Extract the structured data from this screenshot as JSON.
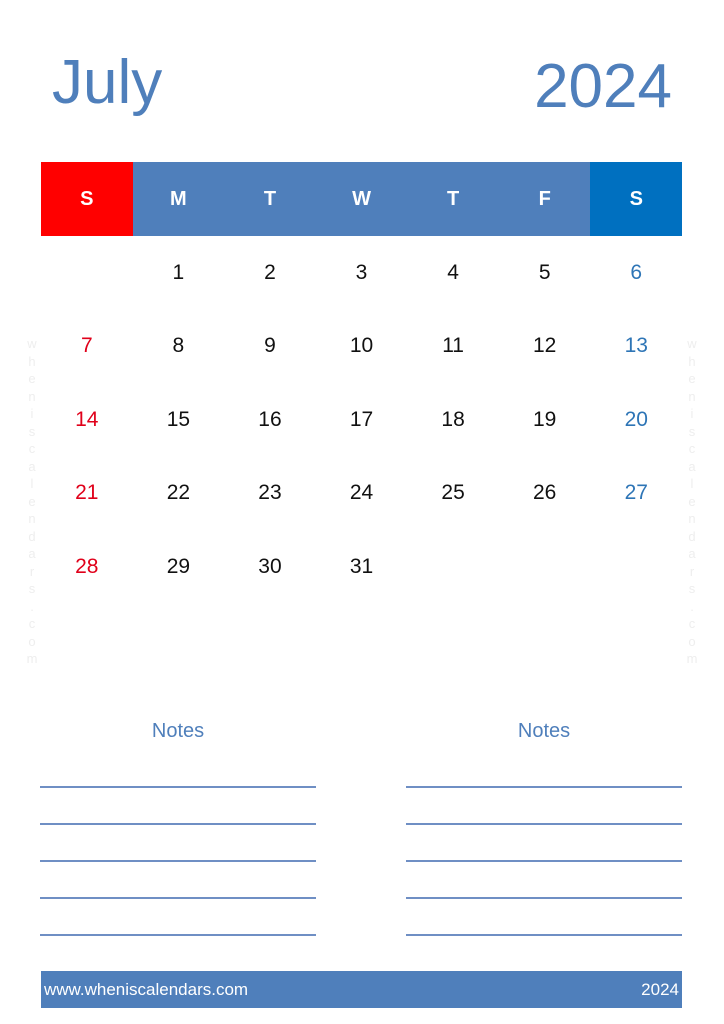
{
  "header": {
    "month": "July",
    "year": "2024"
  },
  "weekdays": [
    "S",
    "M",
    "T",
    "W",
    "T",
    "F",
    "S"
  ],
  "weeks": [
    [
      "",
      "1",
      "2",
      "3",
      "4",
      "5",
      "6"
    ],
    [
      "7",
      "8",
      "9",
      "10",
      "11",
      "12",
      "13"
    ],
    [
      "14",
      "15",
      "16",
      "17",
      "18",
      "19",
      "20"
    ],
    [
      "21",
      "22",
      "23",
      "24",
      "25",
      "26",
      "27"
    ],
    [
      "28",
      "29",
      "30",
      "31",
      "",
      "",
      ""
    ]
  ],
  "colors": {
    "accent": "#4f7fbb",
    "sunday": "#ff0000",
    "saturday": "#0070c0"
  },
  "watermark": "wheniscalendars.com",
  "notes": {
    "left_title": "Notes",
    "right_title": "Notes",
    "line_count": 5
  },
  "footer": {
    "url": "www.wheniscalendars.com",
    "year": "2024"
  }
}
